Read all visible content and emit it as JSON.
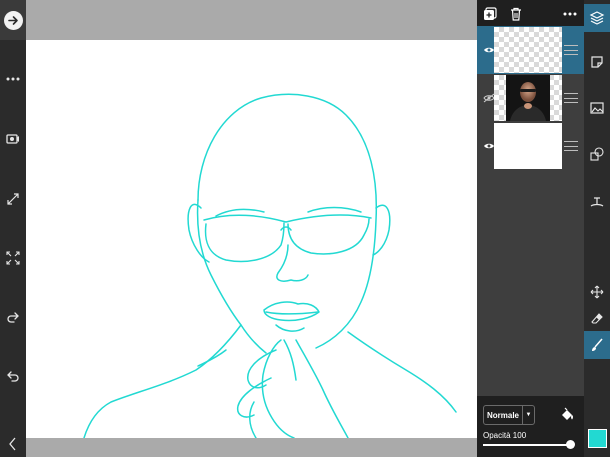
{
  "left_toolbar": {
    "icons": [
      "arrow-right-icon",
      "more-icon",
      "video-icon",
      "resize-icon",
      "fit-screen-icon",
      "redo-icon",
      "undo-icon",
      "back-icon"
    ]
  },
  "layers_panel": {
    "header_icons": [
      "add-layer-icon",
      "delete-layer-icon",
      "more-icon"
    ],
    "layers": [
      {
        "name": "sketch-layer",
        "visible": true,
        "selected": true
      },
      {
        "name": "photo-layer",
        "visible": false,
        "selected": false
      },
      {
        "name": "background-layer",
        "visible": true,
        "selected": false
      }
    ],
    "blend_mode": "Normale",
    "opacity_label": "Opacità 100",
    "opacity_value": 100
  },
  "right_toolbar": {
    "icons": [
      "layers-icon",
      "sticker-icon",
      "image-icon",
      "shapes-icon",
      "text-icon",
      "move-icon",
      "eraser-icon",
      "brush-icon"
    ],
    "active_tools": [
      "layers-icon",
      "brush-icon"
    ]
  },
  "colors": {
    "sketch_stroke": "#22d9d2",
    "selected_layer": "#2c6c8c",
    "current_color": "#22d9d2"
  }
}
